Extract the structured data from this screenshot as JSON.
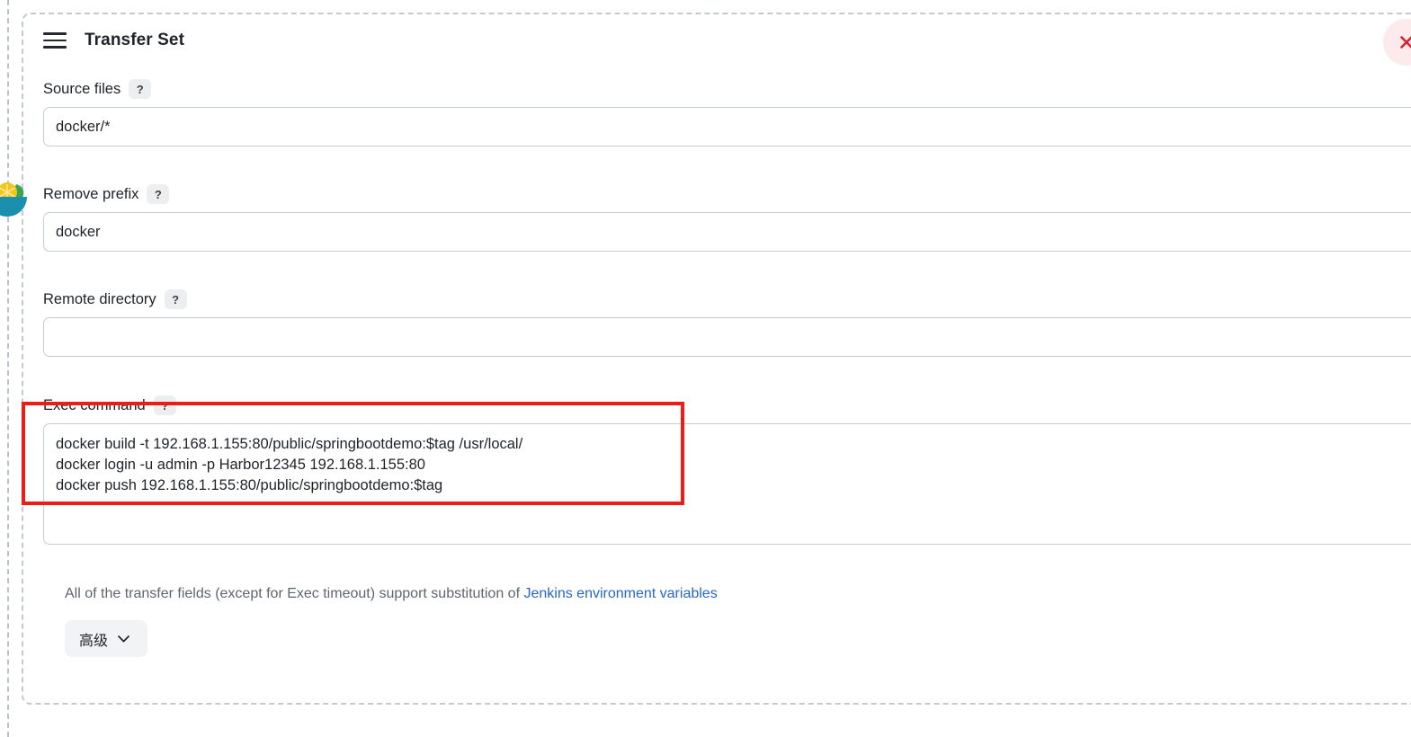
{
  "panel": {
    "title": "Transfer Set",
    "drag_handle_icon": "hamburger-drag-icon",
    "close_icon": "close-x-icon",
    "close_icon_color": "#d9202a",
    "close_bg_color": "#fdeaec"
  },
  "decor": {
    "bowl_icon": "bowl-salad-icon",
    "bowl_colors": {
      "bowl": "#1b8fae",
      "lemon": "#f5c518",
      "leaf": "#3aa655",
      "tomato": "#c0392b"
    }
  },
  "fields": [
    {
      "label": "Source files",
      "help": "?",
      "value": "docker/*",
      "placeholder": ""
    },
    {
      "label": "Remove prefix",
      "help": "?",
      "value": "docker",
      "placeholder": ""
    },
    {
      "label": "Remote directory",
      "help": "?",
      "value": "",
      "placeholder": ""
    }
  ],
  "exec": {
    "label": "Exec command",
    "help": "?",
    "value": "docker build -t 192.168.1.155:80/public/springbootdemo:$tag /usr/local/\ndocker login -u admin -p Harbor12345 192.168.1.155:80\ndocker push 192.168.1.155:80/public/springbootdemo:$tag",
    "placeholder": ""
  },
  "annotation": {
    "type": "rectangle-highlight",
    "color": "#ee1c16"
  },
  "footer": {
    "note_prefix": "All of the transfer fields (except for Exec timeout) support substitution of ",
    "link_text": "Jenkins environment variables",
    "link_color": "#2767c8"
  },
  "advanced": {
    "label": "高级",
    "chevron_icon": "chevron-down-icon"
  }
}
